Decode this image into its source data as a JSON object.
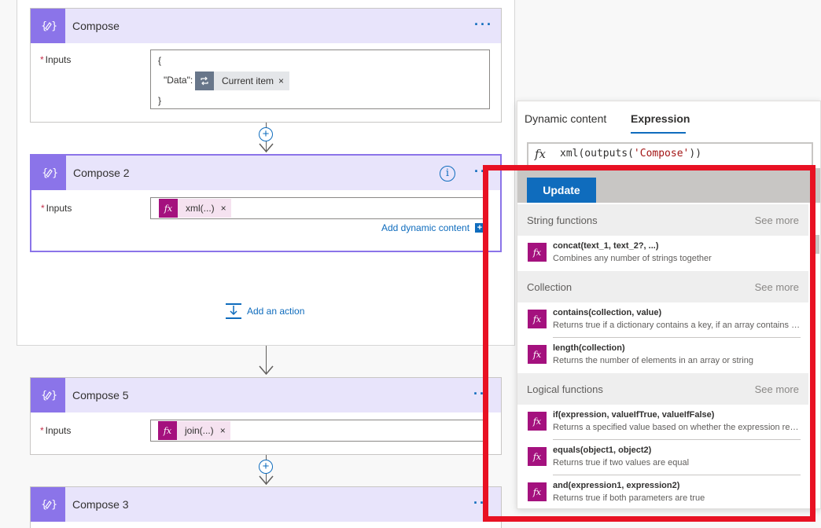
{
  "cards": {
    "compose": {
      "title": "Compose",
      "more_label": "···",
      "inputs_label": "Inputs",
      "required_mark": "*",
      "json_open": "{",
      "json_key": "\"Data\":",
      "json_close": "}",
      "token_label": "Current item",
      "token_remove": "×"
    },
    "compose2": {
      "title": "Compose 2",
      "more_label": "··",
      "info_label": "i",
      "inputs_label": "Inputs",
      "required_mark": "*",
      "token_label": "xml(...)",
      "token_remove": "×",
      "add_dynamic_label": "Add dynamic content",
      "add_dynamic_plus": "+"
    },
    "compose5": {
      "title": "Compose 5",
      "more_label": "··",
      "inputs_label": "Inputs",
      "required_mark": "*",
      "token_label": "join(...)",
      "token_remove": "×"
    },
    "compose3": {
      "title": "Compose 3",
      "more_label": "··"
    }
  },
  "add_action_label": "Add an action",
  "insert_step_symbol": "+",
  "popup": {
    "tabs": [
      "Dynamic content",
      "Expression"
    ],
    "active_tab": "Expression",
    "fx_symbol": "fx",
    "expression_prefix": "xml(outputs(",
    "expression_string": "'Compose'",
    "expression_suffix": "))",
    "update_label": "Update",
    "sections": [
      {
        "title": "String functions",
        "see_more": "See more",
        "functions": [
          {
            "name": "concat(text_1, text_2?, ...)",
            "desc": "Combines any number of strings together"
          }
        ]
      },
      {
        "title": "Collection",
        "see_more": "See more",
        "functions": [
          {
            "name": "contains(collection, value)",
            "desc": "Returns true if a dictionary contains a key, if an array contains a value, or if a string contains a substring"
          },
          {
            "name": "length(collection)",
            "desc": "Returns the number of elements in an array or string"
          }
        ]
      },
      {
        "title": "Logical functions",
        "see_more": "See more",
        "functions": [
          {
            "name": "if(expression, valueIfTrue, valueIfFalse)",
            "desc": "Returns a specified value based on whether the expression resulted in true or false"
          },
          {
            "name": "equals(object1, object2)",
            "desc": "Returns true if two values are equal"
          },
          {
            "name": "and(expression1, expression2)",
            "desc": "Returns true if both parameters are true"
          }
        ]
      }
    ]
  },
  "colors": {
    "card_header": "#e8e4fb",
    "card_icon": "#8b74e9",
    "expression_token": "#a4117e",
    "accent": "#0f6cbd",
    "highlight_box": "#e81123"
  }
}
